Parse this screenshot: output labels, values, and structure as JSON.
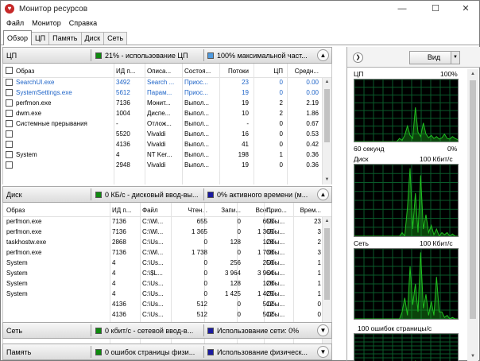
{
  "window": {
    "title": "Монитор ресурсов",
    "min": "—",
    "max": "☐",
    "close": "✕"
  },
  "menu": [
    "Файл",
    "Монитор",
    "Справка"
  ],
  "tabs": [
    "Обзор",
    "ЦП",
    "Память",
    "Диск",
    "Сеть"
  ],
  "cpu": {
    "section": "ЦП",
    "stat1": "21% - использование ЦП",
    "stat2": "100% максимальной част...",
    "stat1_color": "#0e8a0e",
    "stat2_color": "#4f9be0",
    "headers": [
      "Образ",
      "ИД п...",
      "Описа...",
      "Состоя...",
      "Потоки",
      "ЦП",
      "Средн..."
    ],
    "rows": [
      {
        "img": "SearchUI.exe",
        "pid": "3492",
        "desc": "Search ...",
        "state": "Приос...",
        "thr": "23",
        "cpu": "0",
        "avg": "0.00",
        "blue": true,
        "blurred": false
      },
      {
        "img": "SystemSettings.exe",
        "pid": "5612",
        "desc": "Парам...",
        "state": "Приос...",
        "thr": "19",
        "cpu": "0",
        "avg": "0.00",
        "blue": true,
        "blurred": false
      },
      {
        "img": "perfmon.exe",
        "pid": "7136",
        "desc": "Монит...",
        "state": "Выпол...",
        "thr": "19",
        "cpu": "2",
        "avg": "2.19",
        "blue": false,
        "blurred": false
      },
      {
        "img": "dwm.exe",
        "pid": "1004",
        "desc": "Диспе...",
        "state": "Выпол...",
        "thr": "10",
        "cpu": "2",
        "avg": "1.86",
        "blue": false,
        "blurred": false
      },
      {
        "img": "Системные прерывания",
        "pid": "-",
        "desc": "Отлож...",
        "state": "Выпол...",
        "thr": "-",
        "cpu": "0",
        "avg": "0.67",
        "blue": false,
        "blurred": false
      },
      {
        "img": "",
        "pid": "5520",
        "desc": "Vivaldi",
        "state": "Выпол...",
        "thr": "16",
        "cpu": "0",
        "avg": "0.53",
        "blue": false,
        "blurred": true
      },
      {
        "img": "",
        "pid": "4136",
        "desc": "Vivaldi",
        "state": "Выпол...",
        "thr": "41",
        "cpu": "0",
        "avg": "0.42",
        "blue": false,
        "blurred": true
      },
      {
        "img": "System",
        "pid": "4",
        "desc": "NT Ker...",
        "state": "Выпол...",
        "thr": "198",
        "cpu": "1",
        "avg": "0.36",
        "blue": false,
        "blurred": false
      },
      {
        "img": "",
        "pid": "2948",
        "desc": "Vivaldi",
        "state": "Выпол...",
        "thr": "19",
        "cpu": "0",
        "avg": "0.36",
        "blue": false,
        "blurred": true
      }
    ]
  },
  "disk": {
    "section": "Диск",
    "stat1": "0 КБ/с - дисковый ввод-вы...",
    "stat2": "0% активного времени (м...",
    "stat1_color": "#0e8a0e",
    "stat2_color": "#1a1aa0",
    "headers": [
      "Образ",
      "ИД п...",
      "Файл",
      "Чтен...",
      "Запи...",
      "Всег...",
      "Прио...",
      "Врем..."
    ],
    "rows": [
      {
        "img": "perfmon.exe",
        "pid": "7136",
        "file": "C:\\Wi...",
        "read": "655",
        "write": "0",
        "total": "655",
        "prio": "Обы...",
        "time": "23",
        "blurred": false
      },
      {
        "img": "perfmon.exe",
        "pid": "7136",
        "file": "C:\\Wi...",
        "read": "1 365",
        "write": "0",
        "total": "1 365",
        "prio": "Обы...",
        "time": "3",
        "blurred": false
      },
      {
        "img": "taskhostw.exe",
        "pid": "2868",
        "file": "C:\\Us...",
        "read": "0",
        "write": "128",
        "total": "128",
        "prio": "Обы...",
        "time": "2",
        "blurred": false
      },
      {
        "img": "perfmon.exe",
        "pid": "7136",
        "file": "C:\\Wi...",
        "read": "1 738",
        "write": "0",
        "total": "1 738",
        "prio": "Обы...",
        "time": "3",
        "blurred": false
      },
      {
        "img": "System",
        "pid": "4",
        "file": "C:\\Us...",
        "read": "0",
        "write": "256",
        "total": "256",
        "prio": "Обы...",
        "time": "1",
        "blurred": false
      },
      {
        "img": "System",
        "pid": "4",
        "file": "C:\\$L...",
        "read": "0",
        "write": "3 964",
        "total": "3 964",
        "prio": "Обы...",
        "time": "1",
        "blurred": false
      },
      {
        "img": "System",
        "pid": "4",
        "file": "C:\\Us...",
        "read": "0",
        "write": "128",
        "total": "128",
        "prio": "Обы...",
        "time": "1",
        "blurred": false
      },
      {
        "img": "System",
        "pid": "4",
        "file": "C:\\Us...",
        "read": "0",
        "write": "1 425",
        "total": "1 425",
        "prio": "Обы...",
        "time": "1",
        "blurred": false
      },
      {
        "img": "",
        "pid": "4136",
        "file": "C:\\Us...",
        "read": "512",
        "write": "0",
        "total": "512",
        "prio": "Обы...",
        "time": "0",
        "blurred": true
      },
      {
        "img": "",
        "pid": "4136",
        "file": "C:\\Us...",
        "read": "512",
        "write": "0",
        "total": "512",
        "prio": "Обы...",
        "time": "0",
        "blurred": true
      }
    ]
  },
  "net": {
    "section": "Сеть",
    "stat1": "0 кбит/с - сетевой ввод-в...",
    "stat2": "Использование сети: 0%",
    "stat1_color": "#0e8a0e",
    "stat2_color": "#1a1aa0"
  },
  "mem": {
    "section": "Память",
    "stat1": "0 ошибок страницы физи...",
    "stat2": "Использование физическ...",
    "stat1_color": "#0e8a0e",
    "stat2_color": "#1a1aa0"
  },
  "panel": {
    "view_label": "Вид",
    "cpu_graph": {
      "label": "ЦП",
      "max": "100%",
      "bottom_left": "60 секунд",
      "bottom_right": "0%"
    },
    "disk_graph": {
      "label": "Диск",
      "max": "100 Кбит/с"
    },
    "net_graph": {
      "label": "Сеть",
      "max": "100 Кбит/с"
    },
    "mem_graph": {
      "label": "100 ошибок страницы/с"
    },
    "graph_color": "#1fbf1f",
    "grid_color": "#0a5a2a"
  }
}
